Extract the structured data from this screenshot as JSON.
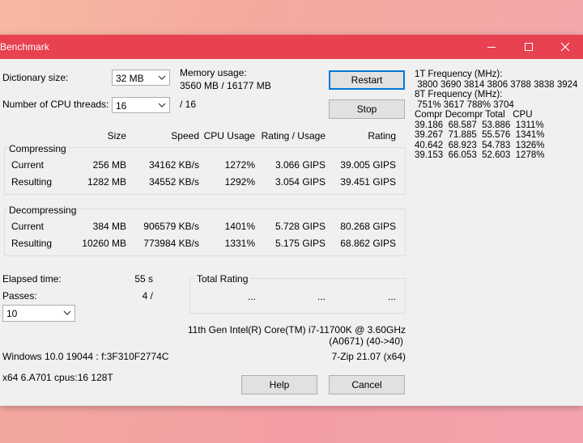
{
  "window": {
    "title": "Benchmark"
  },
  "settings": {
    "dict_label": "Dictionary size:",
    "dict_value": "32 MB",
    "threads_label": "Number of CPU threads:",
    "threads_value": "16",
    "threads_max": "/ 16",
    "memory_label": "Memory usage:",
    "memory_value": "3560 MB / 16177 MB"
  },
  "buttons": {
    "restart": "Restart",
    "stop": "Stop",
    "help": "Help",
    "cancel": "Cancel"
  },
  "columns": {
    "size": "Size",
    "speed": "Speed",
    "cpu_usage": "CPU Usage",
    "rating_usage": "Rating / Usage",
    "rating": "Rating"
  },
  "compressing": {
    "title": "Compressing",
    "rows": [
      {
        "label": "Current",
        "size": "256 MB",
        "speed": "34162 KB/s",
        "cpu": "1272%",
        "ru": "3.066 GIPS",
        "rating": "39.005 GIPS"
      },
      {
        "label": "Resulting",
        "size": "1282 MB",
        "speed": "34552 KB/s",
        "cpu": "1292%",
        "ru": "3.054 GIPS",
        "rating": "39.451 GIPS"
      }
    ]
  },
  "decompressing": {
    "title": "Decompressing",
    "rows": [
      {
        "label": "Current",
        "size": "384 MB",
        "speed": "906579 KB/s",
        "cpu": "1401%",
        "ru": "5.728 GIPS",
        "rating": "80.268 GIPS"
      },
      {
        "label": "Resulting",
        "size": "10260 MB",
        "speed": "773984 KB/s",
        "cpu": "1331%",
        "ru": "5.175 GIPS",
        "rating": "68.862 GIPS"
      }
    ]
  },
  "elapsed": {
    "label": "Elapsed time:",
    "value": "55 s"
  },
  "passes": {
    "label": "Passes:",
    "value": "4 /",
    "select_value": "10"
  },
  "total_rating": {
    "title": "Total Rating",
    "v1": "...",
    "v2": "...",
    "v3": "..."
  },
  "cpu_info": {
    "line1": "11th Gen Intel(R) Core(TM) i7-11700K @ 3.60GHz",
    "line2": "(A0671) (40->40)"
  },
  "sys_info": {
    "os": "Windows 10.0 19044 : f:3F310F2774C",
    "zip": "7-Zip 21.07 (x64)",
    "arch": "x64 6.A701 cpus:16 128T"
  },
  "freq": {
    "l1": "1T Frequency (MHz):",
    "l2": " 3800 3690 3814 3806 3788 3838 3924",
    "l3": "8T Frequency (MHz):",
    "l4": " 751% 3617 788% 3704",
    "l5": "Compr Decompr Total   CPU",
    "l6": "39.186  68.587  53.886  1311%",
    "l7": "39.267  71.885  55.576  1341%",
    "l8": "40.642  68.923  54.783  1326%",
    "l9": "39.153  66.053  52.603  1278%"
  }
}
